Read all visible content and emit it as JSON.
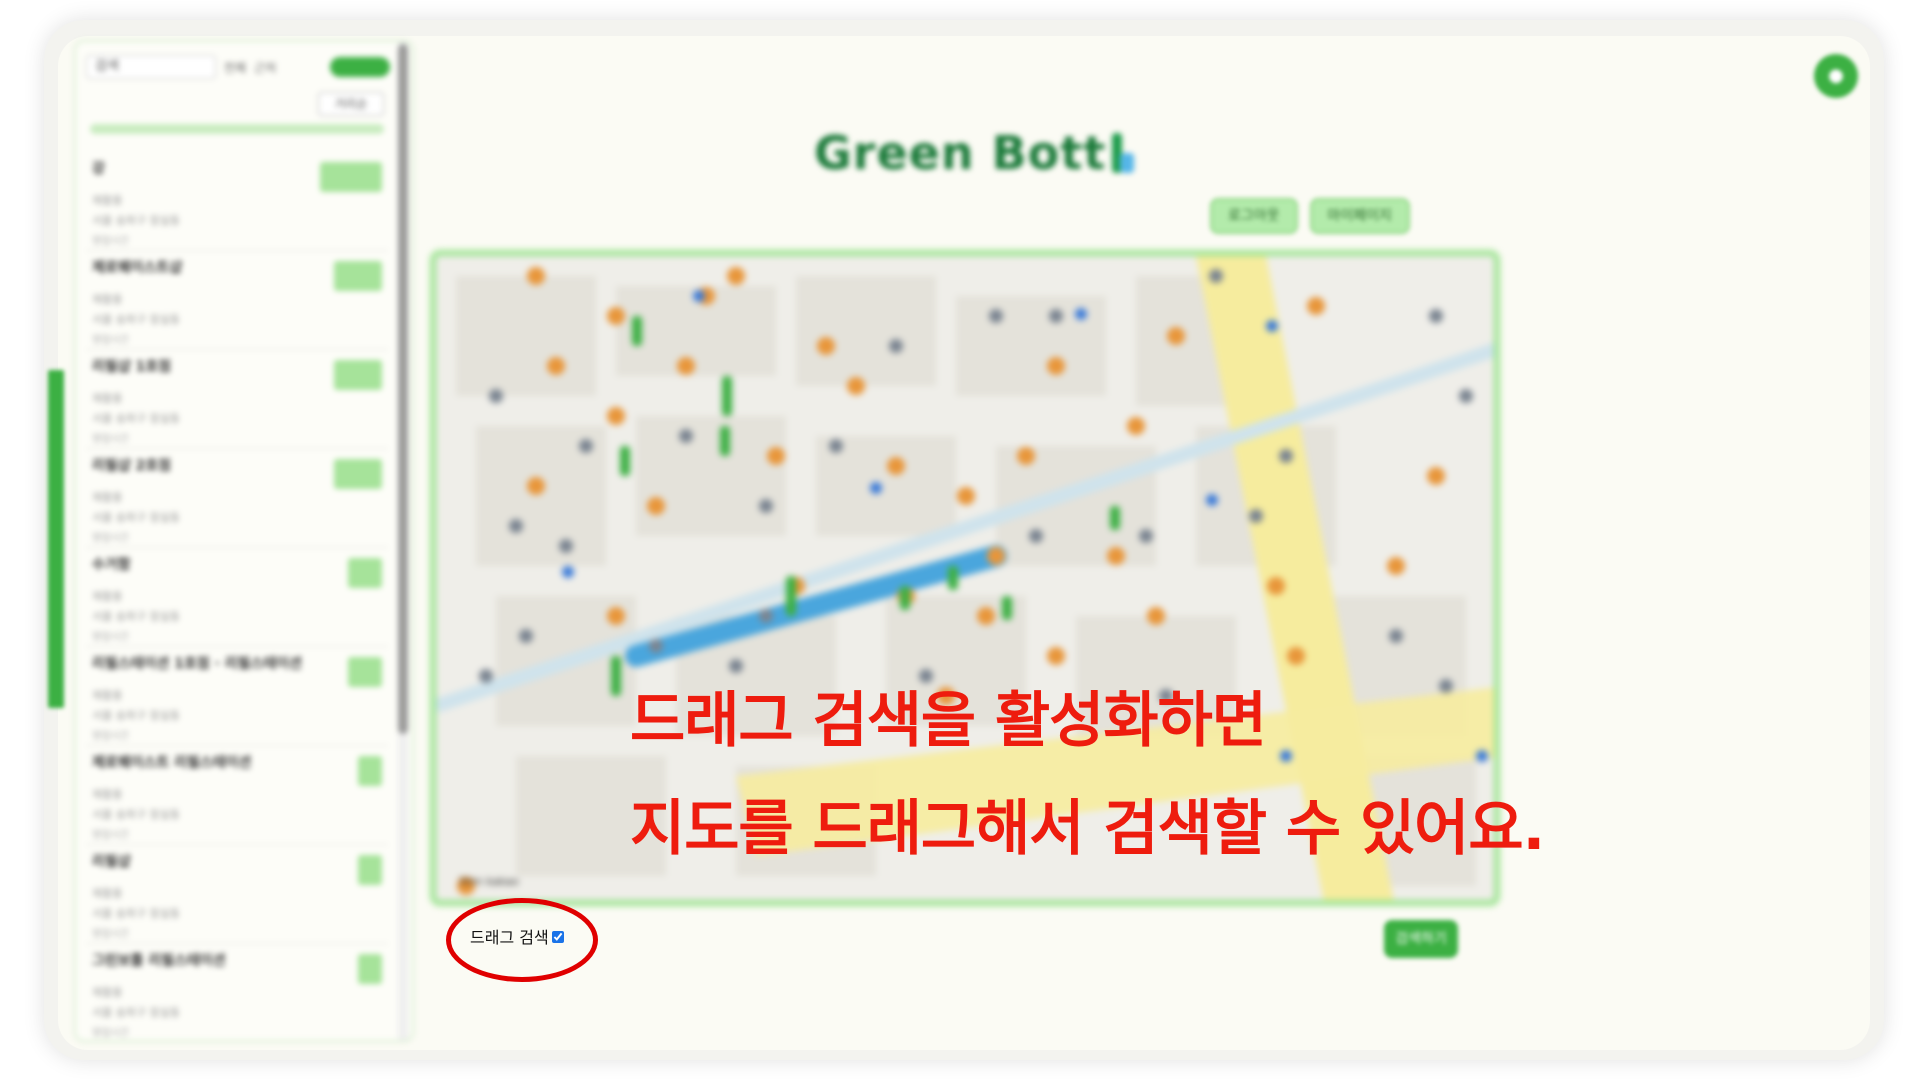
{
  "app": {
    "title": "Green Bottle",
    "logo_text": "Green Bott",
    "brand_color": "#3cb043",
    "accent_color": "#9ee493"
  },
  "header": {
    "buttons": [
      {
        "label": "로그아웃"
      },
      {
        "label": "마이페이지"
      }
    ],
    "profile_icon": "user-icon"
  },
  "sidebar": {
    "search_placeholder": "검색",
    "filter_labels": [
      "전체",
      "근처"
    ],
    "sort_label": "거리순",
    "items": [
      {
        "title": "강",
        "line1": "재활용",
        "line2": "서울 송파구 잠실동",
        "line3": "영업시간",
        "tag_width": 62
      },
      {
        "title": "제로웨이스트샵",
        "line1": "재활용",
        "line2": "서울 송파구 잠실동",
        "line3": "영업시간",
        "tag_width": 48
      },
      {
        "title": "리필샵 1호점",
        "line1": "재활용",
        "line2": "서울 송파구 잠실동",
        "line3": "영업시간",
        "tag_width": 48
      },
      {
        "title": "리필샵 2호점",
        "line1": "재활용",
        "line2": "서울 송파구 잠실동",
        "line3": "영업시간",
        "tag_width": 48
      },
      {
        "title": "수거함",
        "line1": "재활용",
        "line2": "서울 송파구 잠실동",
        "line3": "영업시간",
        "tag_width": 34
      },
      {
        "title": "리필스테이션 1호점 · 리필스테이션",
        "line1": "재활용",
        "line2": "서울 송파구 잠실동",
        "line3": "영업시간",
        "tag_width": 34
      },
      {
        "title": "제로웨이스트 리필스테이션",
        "line1": "재활용",
        "line2": "서울 송파구 잠실동",
        "line3": "영업시간",
        "tag_width": 24
      },
      {
        "title": "리필샵",
        "line1": "재활용",
        "line2": "서울 송파구 잠실동",
        "line3": "영업시간",
        "tag_width": 24
      },
      {
        "title": "그린보틀 리필스테이션",
        "line1": "재활용",
        "line2": "서울 송파구 잠실동",
        "line3": "영업시간",
        "tag_width": 24
      }
    ]
  },
  "map": {
    "credit": "30m  kakao"
  },
  "search_button": {
    "label": "검색하기"
  },
  "drag_search": {
    "label": "드래그 검색",
    "checked": true
  },
  "overlay_caption": {
    "line1": "드래그 검색을 활성화하면",
    "line2": "지도를 드래그해서 검색할 수 있어요.",
    "color": "#ee1c0e"
  }
}
